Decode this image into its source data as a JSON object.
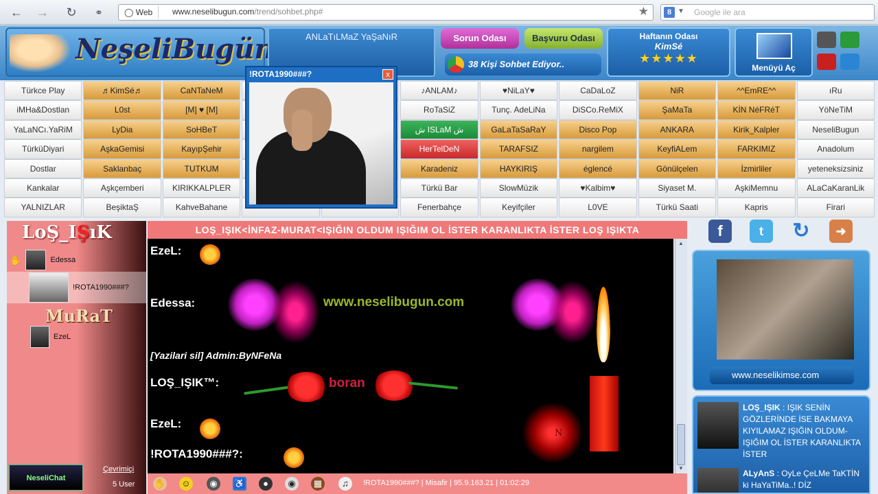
{
  "browser": {
    "web_label": "Web",
    "url_host": "www.neselibugun.com",
    "url_path": "/trend/sohbet.php#",
    "search_placeholder": "Google ile ara"
  },
  "header": {
    "logo_text": "NeşeliBugün",
    "marquee_text": "ANLaTıLMaZ YaŞaNıR",
    "sorun_button": "Sorun Odası",
    "basvuru_button": "Başvuru Odası",
    "status_text": "38 Kişi Sohbet Ediyor..",
    "week_title": "Haftanın Odası",
    "week_name": "KimSé",
    "week_stars": "★★★★★",
    "menu_label": "Menüyü Aç"
  },
  "rooms": [
    [
      {
        "t": "Türkce Play",
        "c": "s"
      },
      {
        "t": "♬KimSé♬",
        "c": "o"
      },
      {
        "t": "CaNTaNeM",
        "c": "o"
      },
      {
        "t": "",
        "c": "s"
      },
      {
        "t": "",
        "c": "s"
      },
      {
        "t": "♪ANLAM♪",
        "c": "s"
      },
      {
        "t": "♥NiLaY♥",
        "c": "s"
      },
      {
        "t": "CaDaLoZ",
        "c": "s"
      },
      {
        "t": "NiR",
        "c": "o"
      },
      {
        "t": "^^EmRE^^",
        "c": "o"
      },
      {
        "t": "ıRu",
        "c": "s"
      }
    ],
    [
      {
        "t": "iMHa&Dostlan",
        "c": "s"
      },
      {
        "t": "L0st",
        "c": "o"
      },
      {
        "t": "[M] ♥ [M]",
        "c": "o"
      },
      {
        "t": "",
        "c": "s"
      },
      {
        "t": "",
        "c": "s"
      },
      {
        "t": "RoTaSiZ",
        "c": "s"
      },
      {
        "t": "Tunç. AdeLiNa",
        "c": "s"
      },
      {
        "t": "DiSCo.ReMiX",
        "c": "s"
      },
      {
        "t": "ŞaMaTa",
        "c": "o"
      },
      {
        "t": "KİN NéFRéT",
        "c": "o"
      },
      {
        "t": "YöNeTiM",
        "c": "s"
      }
    ],
    [
      {
        "t": "YaLaNCı.YaRiM",
        "c": "s"
      },
      {
        "t": "LyDia",
        "c": "o"
      },
      {
        "t": "SoHBeT",
        "c": "o"
      },
      {
        "t": "",
        "c": "s"
      },
      {
        "t": "",
        "c": "s"
      },
      {
        "t": "ش ISLaM ش",
        "c": "g"
      },
      {
        "t": "GaLaTaSaRaY",
        "c": "o"
      },
      {
        "t": "Disco Pop",
        "c": "o"
      },
      {
        "t": "ANKARA",
        "c": "o"
      },
      {
        "t": "Kirik_Kalpler",
        "c": "o"
      },
      {
        "t": "NeseliBugun",
        "c": "s"
      }
    ],
    [
      {
        "t": "TürküDiyari",
        "c": "s"
      },
      {
        "t": "AşkaGemisi",
        "c": "o"
      },
      {
        "t": "KayıpŞehir",
        "c": "o"
      },
      {
        "t": "",
        "c": "s"
      },
      {
        "t": "",
        "c": "s"
      },
      {
        "t": "HerTelDeN",
        "c": "r"
      },
      {
        "t": "TARAFSIZ",
        "c": "o"
      },
      {
        "t": "nargilem",
        "c": "o"
      },
      {
        "t": "KeyfiALem",
        "c": "o"
      },
      {
        "t": "FARKIMIZ",
        "c": "o"
      },
      {
        "t": "Anadolum",
        "c": "s"
      }
    ],
    [
      {
        "t": "Dostlar",
        "c": "s"
      },
      {
        "t": "Saklanbaç",
        "c": "o"
      },
      {
        "t": "TUTKUM",
        "c": "o"
      },
      {
        "t": "",
        "c": "s"
      },
      {
        "t": "",
        "c": "s"
      },
      {
        "t": "Karadeniz",
        "c": "o"
      },
      {
        "t": "HAYKIRIŞ",
        "c": "o"
      },
      {
        "t": "églencé",
        "c": "o"
      },
      {
        "t": "Gönülçelen",
        "c": "o"
      },
      {
        "t": "İzmirliler",
        "c": "o"
      },
      {
        "t": "yeteneksizsiniz",
        "c": "s"
      }
    ],
    [
      {
        "t": "Kankalar",
        "c": "s"
      },
      {
        "t": "Aşkçemberi",
        "c": "s"
      },
      {
        "t": "KIRIKKALPLER",
        "c": "s"
      },
      {
        "t": "",
        "c": "s"
      },
      {
        "t": "",
        "c": "s"
      },
      {
        "t": "Türkü Bar",
        "c": "s"
      },
      {
        "t": "SlowMüzik",
        "c": "s"
      },
      {
        "t": "♥Kalbim♥",
        "c": "s"
      },
      {
        "t": "Siyaset M.",
        "c": "s"
      },
      {
        "t": "AşkiMemnu",
        "c": "s"
      },
      {
        "t": "ALaCaKaranLik",
        "c": "s"
      }
    ],
    [
      {
        "t": "YALNIZLAR",
        "c": "s"
      },
      {
        "t": "BeşiktaŞ",
        "c": "s"
      },
      {
        "t": "KahveBahane",
        "c": "s"
      },
      {
        "t": "",
        "c": "s"
      },
      {
        "t": "",
        "c": "s"
      },
      {
        "t": "Fenerbahçe",
        "c": "s"
      },
      {
        "t": "Keyifçiler",
        "c": "s"
      },
      {
        "t": "L0VE",
        "c": "s"
      },
      {
        "t": "Türkü Saati",
        "c": "s"
      },
      {
        "t": "Kapris",
        "c": "s"
      },
      {
        "t": "Firari",
        "c": "s"
      }
    ]
  ],
  "cam": {
    "title": "!ROTA1990###?",
    "close": "x"
  },
  "left": {
    "room_title_a": "LoŞ_I",
    "room_title_b": "Ş",
    "room_title_c": "ıK",
    "users": [
      {
        "name": "Edessa"
      },
      {
        "name": "!ROTA1990###?"
      },
      {
        "name": "EzeL"
      }
    ],
    "murat": "MuRaT",
    "logo_text": "NeseliChat",
    "online_label": "Çevrimiçi",
    "user_count": "5 User"
  },
  "topic": "LOŞ_IŞIK<İNFAZ-MURAT<IŞIĞIN OLDUM IŞIĞIM OL İSTER KARANLIKTA İSTER LOŞ IŞIKTA",
  "chat": {
    "n1": "EzeL:",
    "n2": "Edessa:",
    "site": "www.neselibugun.com",
    "admin": "[Yazilari sil] Admin:ByNFeNa",
    "n3": "LOŞ_IŞIK™:",
    "boran": "boran",
    "n4": "EzeL:",
    "n5": "!ROTA1990###?:",
    "glow_text": "N"
  },
  "bottom": {
    "status": "!ROTA1990###? | Misafir | 95.9.163.21 | 01:02:29"
  },
  "right": {
    "promo_url": "www.neselikimse.com",
    "feed": [
      {
        "user": "LOŞ_IŞIK",
        "text": " : IŞIK SENİN GÖZLERİNDE İSE BAKMAYA KIYILAMAZ IŞIĞIN OLDUM-IŞIĞIM OL İSTER KARANLIKTA İSTER"
      },
      {
        "user": "ALyAnS",
        "text": " : OyLe ÇeLMe TaKTİN ki HaYaTiMa..! DİZ"
      }
    ]
  },
  "colors": {
    "topic_bar": "#f07878",
    "chat_bg": "#000000",
    "header": "#3c86c8",
    "room_orange": "#d89a3a"
  }
}
